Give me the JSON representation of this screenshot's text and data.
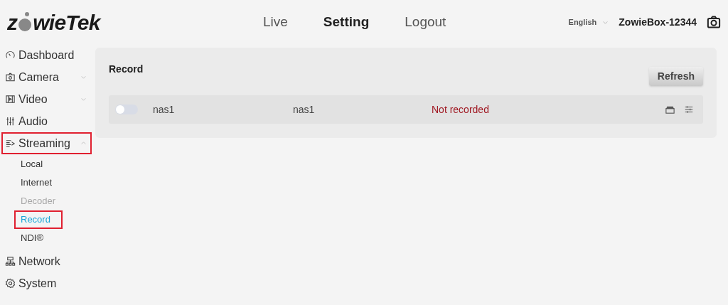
{
  "header": {
    "logo": {
      "before": "z",
      "after": "wieTek"
    },
    "nav": [
      {
        "label": "Live",
        "selected": false
      },
      {
        "label": "Setting",
        "selected": true
      },
      {
        "label": "Logout",
        "selected": false
      }
    ],
    "language": "English",
    "device_name": "ZowieBox-12344"
  },
  "sidebar": {
    "items": [
      {
        "label": "Dashboard"
      },
      {
        "label": "Camera",
        "expanded": false
      },
      {
        "label": "Video",
        "expanded": false
      },
      {
        "label": "Audio"
      },
      {
        "label": "Streaming",
        "expanded": true,
        "highlighted": true,
        "children": [
          {
            "label": "Local",
            "selected": false,
            "disabled": false,
            "highlighted": false
          },
          {
            "label": "Internet",
            "selected": false,
            "disabled": false,
            "highlighted": false
          },
          {
            "label": "Decoder",
            "selected": false,
            "disabled": true,
            "highlighted": false
          },
          {
            "label": "Record",
            "selected": true,
            "disabled": false,
            "highlighted": true
          },
          {
            "label": "NDI®",
            "selected": false,
            "disabled": false,
            "highlighted": false
          }
        ]
      },
      {
        "label": "Network"
      },
      {
        "label": "System"
      }
    ]
  },
  "panel": {
    "title": "Record",
    "refresh_button": "Refresh",
    "rows": [
      {
        "on": false,
        "name": "nas1",
        "column_3": "nas1",
        "status": "Not recorded"
      }
    ]
  }
}
